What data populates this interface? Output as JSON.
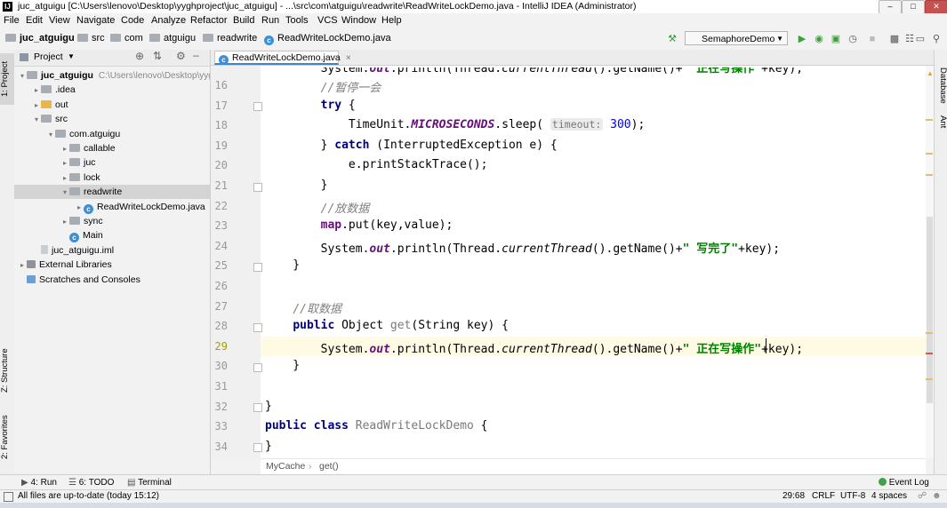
{
  "window": {
    "title": "juc_atguigu [C:\\Users\\lenovo\\Desktop\\yyghproject\\juc_atguigu] - ...\\src\\com\\atguigu\\readwrite\\ReadWriteLockDemo.java - IntelliJ IDEA (Administrator)",
    "btn_min": "–",
    "btn_max": "□",
    "btn_close": "✕"
  },
  "menu": [
    "File",
    "Edit",
    "View",
    "Navigate",
    "Code",
    "Analyze",
    "Refactor",
    "Build",
    "Run",
    "Tools",
    "VCS",
    "Window",
    "Help"
  ],
  "breadcrumb": [
    "juc_atguigu",
    "src",
    "com",
    "atguigu",
    "readwrite",
    "ReadWriteLockDemo.java"
  ],
  "run_config": "SemaphoreDemo",
  "left_tabs": {
    "project": "1: Project",
    "structure": "Z: Structure",
    "favorites": "2: Favorites"
  },
  "right_tabs": {
    "database": "Database",
    "ant": "Ant"
  },
  "project_panel": {
    "title": "Project",
    "tree": [
      {
        "label": "juc_atguigu",
        "extra": "C:\\Users\\lenovo\\Desktop\\yygh",
        "depth": 0,
        "arrow": "▾",
        "icon": "folder",
        "bold": true
      },
      {
        "label": ".idea",
        "depth": 1,
        "arrow": "▸",
        "icon": "folder"
      },
      {
        "label": "out",
        "depth": 1,
        "arrow": "▸",
        "icon": "folder-yellow"
      },
      {
        "label": "src",
        "depth": 1,
        "arrow": "▾",
        "icon": "folder"
      },
      {
        "label": "com.atguigu",
        "depth": 2,
        "arrow": "▾",
        "icon": "folder"
      },
      {
        "label": "callable",
        "depth": 3,
        "arrow": "▸",
        "icon": "folder"
      },
      {
        "label": "juc",
        "depth": 3,
        "arrow": "▸",
        "icon": "folder"
      },
      {
        "label": "lock",
        "depth": 3,
        "arrow": "▸",
        "icon": "folder"
      },
      {
        "label": "readwrite",
        "depth": 3,
        "arrow": "▾",
        "icon": "folder",
        "selected": true
      },
      {
        "label": "ReadWriteLockDemo.java",
        "depth": 4,
        "arrow": "▸",
        "icon": "class"
      },
      {
        "label": "sync",
        "depth": 3,
        "arrow": "▸",
        "icon": "folder"
      },
      {
        "label": "Main",
        "depth": 3,
        "arrow": "",
        "icon": "class"
      },
      {
        "label": "juc_atguigu.iml",
        "depth": 1,
        "arrow": "",
        "icon": "file"
      },
      {
        "label": "External Libraries",
        "depth": 0,
        "arrow": "▸",
        "icon": "lib"
      },
      {
        "label": "Scratches and Consoles",
        "depth": 0,
        "arrow": "",
        "icon": "scratch"
      }
    ]
  },
  "editor": {
    "tab": "ReadWriteLockDemo.java",
    "tab_close": "×",
    "breadcrumb": [
      "MyCache",
      "get()"
    ],
    "lines": [
      {
        "n": "16",
        "html": "        <span class='cm'>//暂停一会</span>"
      },
      {
        "n": "17",
        "html": "        <span class='kw'>try</span> {"
      },
      {
        "n": "18",
        "html": "            TimeUnit.<span class='st-f'>MICROSECONDS</span>.sleep( <span class='hint'>timeout:</span> <span class='num'>300</span>);"
      },
      {
        "n": "19",
        "html": "        } <span class='kw'>catch</span> (InterruptedException e) {"
      },
      {
        "n": "20",
        "html": "            e.printStackTrace();"
      },
      {
        "n": "21",
        "html": "        }"
      },
      {
        "n": "22",
        "html": "        <span class='cm'>//放数据</span>"
      },
      {
        "n": "23",
        "html": "        <span class='st-f' style='font-style:normal'>map</span>.put(key,value);"
      },
      {
        "n": "24",
        "html": "        System.<span class='st-f'>out</span>.println(Thread.<span class='it'>currentThread</span>().getName()+<span class='st'>\" 写完了\"</span>+key);"
      },
      {
        "n": "25",
        "html": "    }"
      },
      {
        "n": "26",
        "html": ""
      },
      {
        "n": "27",
        "html": "    <span class='cm'>//取数据</span>"
      },
      {
        "n": "28",
        "html": "    <span class='kw'>public</span> Object <span class='fn'>get</span>(String key) {"
      },
      {
        "n": "29",
        "html": "        System.<span class='st-f'>out</span>.println(Thread.<span class='it'>currentThread</span>().getName()+<span class='st'>\" 正在写操作\"</span>+key);"
      },
      {
        "n": "30",
        "html": "    }"
      },
      {
        "n": "31",
        "html": ""
      },
      {
        "n": "32",
        "html": "}"
      },
      {
        "n": "33",
        "html": "<span class='kw'>public class</span> <span class='fn'>ReadWriteLockDemo</span> {"
      },
      {
        "n": "34",
        "html": "}"
      }
    ],
    "partial_line": "        System.<span class='st-f'>out</span>.println(Thread.<span class='it'>currentThread</span>().getName()+<span class='st'>\" 正在写操作\"</span>+key);"
  },
  "tool_windows": {
    "run": "4: Run",
    "todo": "6: TODO",
    "terminal": "Terminal",
    "event_log": "Event Log"
  },
  "status": {
    "message": "All files are up-to-date (today 15:12)",
    "position": "29:68",
    "line_sep": "CRLF",
    "encoding": "UTF-8",
    "indent": "4 spaces"
  }
}
